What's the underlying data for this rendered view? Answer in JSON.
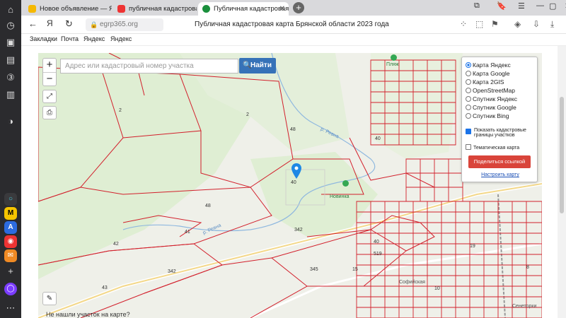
{
  "tabs": [
    {
      "label": "Новое объявление — Янд",
      "color": "#f5b800"
    },
    {
      "label": "публичная кадастровая к",
      "color": "#f5b800"
    },
    {
      "label": "Публичная кадастровая",
      "color": "#1a8f3c"
    }
  ],
  "nav": {
    "url": "egrp365.org",
    "page_title": "Публичная кадастровая карта Брянской области 2023 года"
  },
  "bookmarks": [
    "Закладки",
    "Почта",
    "Яндекс",
    "Яндекс"
  ],
  "search": {
    "placeholder": "Адрес или кадастровый номер участка",
    "button": "Найти"
  },
  "layers": {
    "options": [
      "Карта Яндекс",
      "Карта Google",
      "Карта 2GIS",
      "OpenStreetMap",
      "Спутник Яндекс",
      "Спутник Google",
      "Спутник Bing"
    ],
    "selected": "Карта Яндекс",
    "checkbox_borders": "Показать кадастровые границы участков",
    "checkbox_thematic": "Тематическая карта",
    "share_button": "Поделиться ссылкой",
    "settings_link": "Настроить карту"
  },
  "map_labels": {
    "plyazh": "Пляж",
    "novinka": "Новинка",
    "sofiyskaya": "Софийская",
    "senetorki": "Сенеторки",
    "river1": "р. Ревна",
    "river2": "р. Ревна",
    "parcels": [
      "2",
      "2",
      "48",
      "40",
      "40",
      "48",
      "41",
      "42",
      "342",
      "342",
      "345",
      "43",
      "15",
      "519",
      "40",
      "10",
      "19",
      "8"
    ]
  },
  "bottom_hint": "Не нашли участок на карте?",
  "colors": {
    "accent": "#3672b8",
    "parcel": "#d21f2b",
    "share": "#d9443a"
  },
  "icons": [
    "back-icon",
    "reload-icon",
    "lock-icon",
    "zoom-in-icon",
    "zoom-out-icon",
    "fullscreen-icon",
    "print-icon",
    "ruler-icon",
    "search-icon",
    "map-pin-icon"
  ]
}
